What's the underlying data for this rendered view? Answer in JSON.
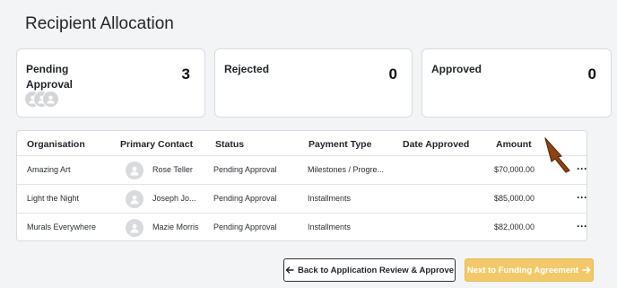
{
  "page": {
    "title": "Recipient Allocation"
  },
  "cards": [
    {
      "label": "Pending Approval",
      "count": "3"
    },
    {
      "label": "Rejected",
      "count": "0"
    },
    {
      "label": "Approved",
      "count": "0"
    }
  ],
  "table": {
    "headers": [
      "Organisation",
      "Primary Contact",
      "Status",
      "Payment Type",
      "Date Approved",
      "Amount"
    ],
    "rows": [
      {
        "organisation": "Amazing Art",
        "contact": "Rose Teller",
        "status": "Pending Approval",
        "payment_type": "Milestones / Progre...",
        "date_approved": "",
        "amount": "$70,000.00",
        "more": "···"
      },
      {
        "organisation": "Light the Night",
        "contact": "Joseph Jo...",
        "status": "Pending Approval",
        "payment_type": "Installments",
        "date_approved": "",
        "amount": "$85,000.00",
        "more": "···"
      },
      {
        "organisation": "Murals Everywhere",
        "contact": "Mazie Morris",
        "status": "Pending Approval",
        "payment_type": "Installments",
        "date_approved": "",
        "amount": "$82,000.00",
        "more": "···"
      }
    ]
  },
  "footer": {
    "back_label": "Back to Application Review & Approve",
    "back_icon": "arrow-left-icon",
    "next_label": "Next to Funding Agreement",
    "next_icon": "arrow-right-icon"
  },
  "colors": {
    "background": "#f3f4f6",
    "next_button": "#f2c96a",
    "cursor": "#8b4513"
  }
}
